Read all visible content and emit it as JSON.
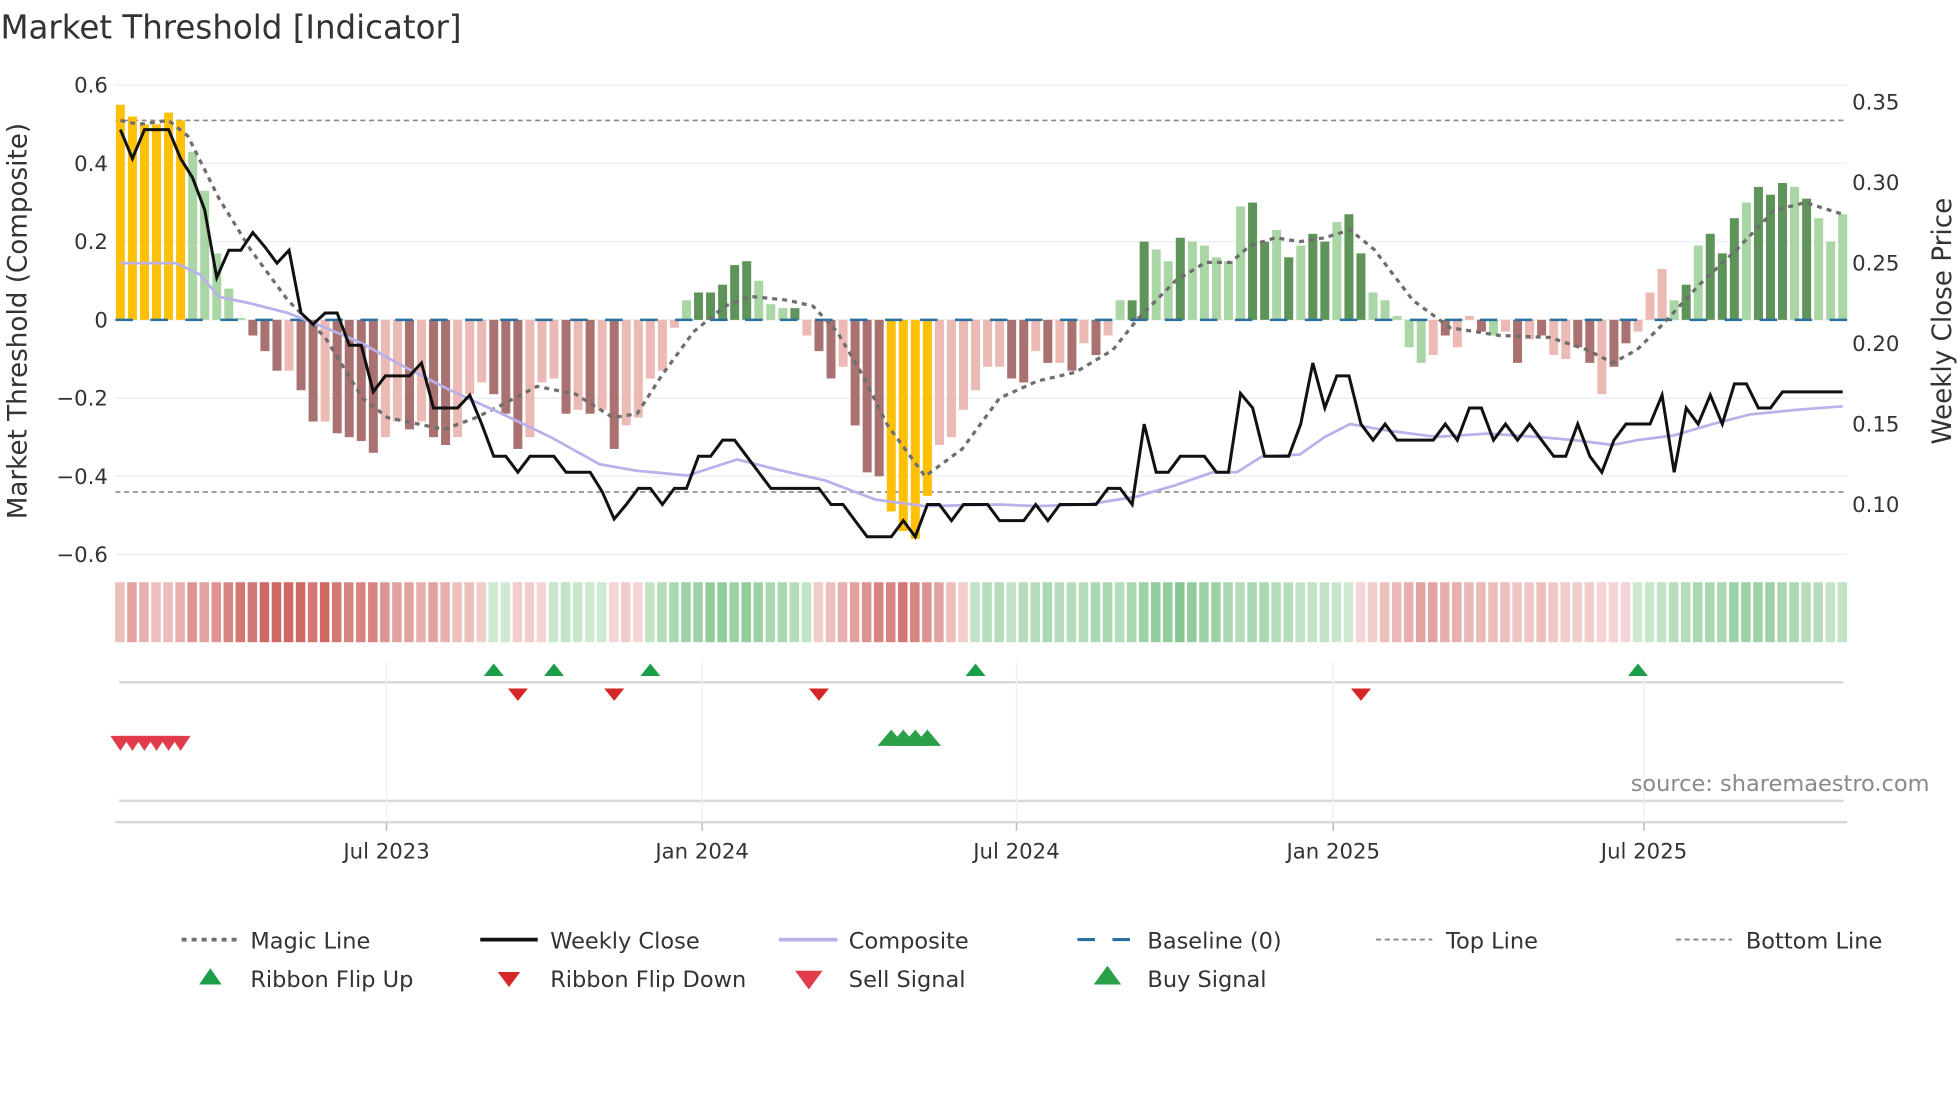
{
  "chart_data": {
    "type": "bar",
    "title": "Market Threshold [Indicator]",
    "ylabel": "Market Threshold (Composite)",
    "y2label": "Weekly Close Price",
    "ylim": [
      -0.6,
      0.6
    ],
    "y2lim": [
      0.1,
      0.35
    ],
    "yticks": [
      "0.6",
      "0.4",
      "0.2",
      "0",
      "−0.2",
      "−0.4",
      "−0.6"
    ],
    "ytick_values": [
      0.6,
      0.4,
      0.2,
      0,
      -0.2,
      -0.4,
      -0.6
    ],
    "y2ticks": [
      "0.35",
      "0.30",
      "0.25",
      "0.20",
      "0.15",
      "0.10"
    ],
    "y2tick_values": [
      0.35,
      0.3,
      0.25,
      0.2,
      0.15,
      0.1
    ],
    "x_unit": "week index (1-144)",
    "xticks": [
      {
        "label": "Jul 2023",
        "week": 23.1
      },
      {
        "label": "Jan 2024",
        "week": 49.3
      },
      {
        "label": "Jul 2024",
        "week": 75.4
      },
      {
        "label": "Jan 2025",
        "week": 101.7
      },
      {
        "label": "Jul 2025",
        "week": 127.5
      }
    ],
    "top_line": 0.51,
    "bottom_line": -0.44,
    "baseline": 0,
    "colors": {
      "Y": "#ffc107",
      "G": "#5e9459",
      "g": "#a9d6a4",
      "R": "#a97170",
      "r": "#ecbab4",
      "close": "#111111",
      "composite": "#b9b1ea",
      "magic": "#6e6e6e",
      "baseline": "#2a6f9e",
      "ribbon_red": "#c95a55",
      "ribbon_green": "#6dbb7a",
      "flip_up": "#1a9e48",
      "flip_down": "#d62728",
      "sell": "#e23b4b",
      "buy": "#2ca048"
    },
    "composite_bars": [
      0.55,
      0.52,
      0.5,
      0.5,
      0.53,
      0.51,
      0.43,
      0.33,
      0.17,
      0.08,
      0.005,
      -0.04,
      -0.08,
      -0.13,
      -0.13,
      -0.18,
      -0.26,
      -0.26,
      -0.29,
      -0.3,
      -0.31,
      -0.34,
      -0.3,
      -0.26,
      -0.28,
      -0.26,
      -0.3,
      -0.32,
      -0.3,
      -0.19,
      -0.16,
      -0.19,
      -0.24,
      -0.33,
      -0.3,
      -0.16,
      -0.15,
      -0.24,
      -0.23,
      -0.24,
      -0.23,
      -0.33,
      -0.27,
      -0.25,
      -0.15,
      -0.13,
      -0.02,
      0.05,
      0.07,
      0.07,
      0.09,
      0.14,
      0.15,
      0.1,
      0.04,
      0.03,
      0.03,
      -0.04,
      -0.08,
      -0.15,
      -0.12,
      -0.27,
      -0.39,
      -0.4,
      -0.49,
      -0.54,
      -0.56,
      -0.45,
      -0.32,
      -0.3,
      -0.23,
      -0.18,
      -0.12,
      -0.12,
      -0.15,
      -0.16,
      -0.08,
      -0.11,
      -0.11,
      -0.13,
      -0.06,
      -0.09,
      -0.04,
      0.05,
      0.05,
      0.2,
      0.18,
      0.15,
      0.21,
      0.2,
      0.19,
      0.16,
      0.15,
      0.29,
      0.3,
      0.2,
      0.23,
      0.16,
      0.19,
      0.22,
      0.2,
      0.25,
      0.27,
      0.17,
      0.07,
      0.05,
      0.01,
      -0.07,
      -0.11,
      -0.09,
      -0.04,
      -0.07,
      0.01,
      -0.03,
      -0.04,
      -0.03,
      -0.11,
      -0.05,
      -0.04,
      -0.09,
      -0.1,
      -0.07,
      -0.11,
      -0.19,
      -0.12,
      -0.06,
      -0.03,
      0.07,
      0.13,
      0.05,
      0.09,
      0.19,
      0.22,
      0.17,
      0.26,
      0.3,
      0.34,
      0.32,
      0.35,
      0.34,
      0.31,
      0.26,
      0.2,
      0.27
    ],
    "bar_color_class": "YYYYYYgggggRRRrRRrRRRRrrRrRRrrrRRRrrrRrRrRrrrrrgGGGGGgggGrRRrRRRYYYYrrrrrrRRrRrRrRrgGGggGgggggGGgGgGGgGGgggggrRrrRgrRrRrrRRrRRrrrgGgGGGgGGGgGgggggG",
    "weekly_close": [
      0.333,
      0.315,
      0.333,
      0.333,
      0.333,
      0.315,
      0.303,
      0.283,
      0.241,
      0.258,
      0.258,
      0.269,
      0.26,
      0.25,
      0.258,
      0.219,
      0.212,
      0.219,
      0.219,
      0.199,
      0.199,
      0.17,
      0.18,
      0.18,
      0.18,
      0.188,
      0.16,
      0.16,
      0.16,
      0.168,
      0.15,
      0.13,
      0.13,
      0.12,
      0.13,
      0.13,
      0.13,
      0.12,
      0.12,
      0.12,
      0.108,
      0.091,
      0.1,
      0.11,
      0.11,
      0.1,
      0.11,
      0.11,
      0.13,
      0.13,
      0.14,
      0.14,
      0.13,
      0.12,
      0.11,
      0.11,
      0.11,
      0.11,
      0.11,
      0.1,
      0.1,
      0.09,
      0.08,
      0.08,
      0.08,
      0.09,
      0.08,
      0.1,
      0.1,
      0.09,
      0.1,
      0.1,
      0.1,
      0.09,
      0.09,
      0.09,
      0.1,
      0.09,
      0.1,
      0.1,
      0.1,
      0.1,
      0.11,
      0.11,
      0.1,
      0.15,
      0.12,
      0.12,
      0.13,
      0.13,
      0.13,
      0.12,
      0.12,
      0.169,
      0.16,
      0.13,
      0.13,
      0.13,
      0.15,
      0.188,
      0.16,
      0.18,
      0.18,
      0.15,
      0.14,
      0.15,
      0.14,
      0.14,
      0.14,
      0.14,
      0.15,
      0.14,
      0.16,
      0.16,
      0.14,
      0.15,
      0.14,
      0.15,
      0.14,
      0.13,
      0.13,
      0.15,
      0.13,
      0.12,
      0.14,
      0.15,
      0.15,
      0.15,
      0.168,
      0.12,
      0.16,
      0.15,
      0.168,
      0.15,
      0.175,
      0.175,
      0.16,
      0.16,
      0.17,
      0.17,
      0.17,
      0.17,
      0.17,
      0.17
    ],
    "composite_line": [
      [
        1,
        0.25
      ],
      [
        5.6,
        0.25
      ],
      [
        7.6,
        0.243
      ],
      [
        9.2,
        0.229
      ],
      [
        11.8,
        0.225
      ],
      [
        14.9,
        0.219
      ],
      [
        18,
        0.21
      ],
      [
        21.1,
        0.2
      ],
      [
        24.2,
        0.187
      ],
      [
        28.4,
        0.171
      ],
      [
        32.5,
        0.157
      ],
      [
        36.7,
        0.142
      ],
      [
        40.8,
        0.125
      ],
      [
        43.9,
        0.121
      ],
      [
        48.1,
        0.118
      ],
      [
        52.2,
        0.128
      ],
      [
        55.4,
        0.122
      ],
      [
        59.5,
        0.115
      ],
      [
        63.7,
        0.103
      ],
      [
        67.8,
        0.099
      ],
      [
        74,
        0.1
      ],
      [
        77.1,
        0.099
      ],
      [
        81.3,
        0.1
      ],
      [
        85.4,
        0.105
      ],
      [
        88.6,
        0.112
      ],
      [
        91.7,
        0.12
      ],
      [
        93.7,
        0.12
      ],
      [
        95.8,
        0.13
      ],
      [
        98.9,
        0.131
      ],
      [
        101,
        0.142
      ],
      [
        103.1,
        0.15
      ],
      [
        106.2,
        0.146
      ],
      [
        110.3,
        0.142
      ],
      [
        114.5,
        0.144
      ],
      [
        118.6,
        0.142
      ],
      [
        121.7,
        0.14
      ],
      [
        124.9,
        0.137
      ],
      [
        126.9,
        0.14
      ],
      [
        130,
        0.143
      ],
      [
        133.2,
        0.15
      ],
      [
        136.3,
        0.156
      ],
      [
        140.4,
        0.159
      ],
      [
        144,
        0.161
      ]
    ],
    "magic_line": [
      [
        1,
        0.51
      ],
      [
        2.5,
        0.5
      ],
      [
        5,
        0.51
      ],
      [
        6.6,
        0.47
      ],
      [
        9.2,
        0.31
      ],
      [
        11.8,
        0.18
      ],
      [
        14.9,
        0.05
      ],
      [
        18,
        -0.045
      ],
      [
        21.1,
        -0.2
      ],
      [
        23.2,
        -0.25
      ],
      [
        26.3,
        -0.27
      ],
      [
        27.9,
        -0.28
      ],
      [
        30.5,
        -0.25
      ],
      [
        32.5,
        -0.22
      ],
      [
        35.6,
        -0.17
      ],
      [
        38.8,
        -0.19
      ],
      [
        41.9,
        -0.25
      ],
      [
        43.9,
        -0.24
      ],
      [
        46,
        -0.14
      ],
      [
        48.6,
        -0.03
      ],
      [
        51.2,
        0.035
      ],
      [
        53.3,
        0.06
      ],
      [
        56.4,
        0.05
      ],
      [
        58.5,
        0.035
      ],
      [
        60.5,
        -0.03
      ],
      [
        62.6,
        -0.14
      ],
      [
        64.7,
        -0.27
      ],
      [
        67.8,
        -0.4
      ],
      [
        70.9,
        -0.33
      ],
      [
        74,
        -0.2
      ],
      [
        77.1,
        -0.157
      ],
      [
        80.3,
        -0.134
      ],
      [
        83.4,
        -0.077
      ],
      [
        85.4,
        0
      ],
      [
        88.6,
        0.1
      ],
      [
        91.1,
        0.147
      ],
      [
        93.2,
        0.147
      ],
      [
        94.8,
        0.19
      ],
      [
        96.9,
        0.21
      ],
      [
        98.9,
        0.2
      ],
      [
        101,
        0.21
      ],
      [
        103.1,
        0.23
      ],
      [
        105.1,
        0.18
      ],
      [
        108.3,
        0.05
      ],
      [
        111.4,
        -0.02
      ],
      [
        115.5,
        -0.04
      ],
      [
        119.7,
        -0.045
      ],
      [
        122.8,
        -0.077
      ],
      [
        124.9,
        -0.11
      ],
      [
        126.9,
        -0.077
      ],
      [
        129,
        -0.013
      ],
      [
        132.1,
        0.09
      ],
      [
        135.2,
        0.18
      ],
      [
        138.3,
        0.28
      ],
      [
        140.9,
        0.3
      ],
      [
        144,
        0.27
      ]
    ],
    "ribbon": [
      -0.3,
      -0.5,
      -0.4,
      -0.3,
      -0.3,
      -0.4,
      -0.6,
      -0.5,
      -0.6,
      -0.7,
      -0.8,
      -0.8,
      -0.9,
      -0.9,
      -0.9,
      -0.9,
      -0.8,
      -0.9,
      -0.8,
      -0.7,
      -0.7,
      -0.7,
      -0.6,
      -0.5,
      -0.5,
      -0.4,
      -0.5,
      -0.4,
      -0.3,
      -0.3,
      -0.2,
      0.2,
      0.2,
      -0.2,
      -0.2,
      -0.15,
      0.25,
      0.3,
      0.25,
      0.2,
      0.2,
      -0.15,
      -0.2,
      -0.15,
      0.3,
      0.4,
      0.5,
      0.6,
      0.6,
      0.7,
      0.7,
      0.6,
      0.7,
      0.6,
      0.5,
      0.5,
      0.4,
      0.3,
      -0.2,
      -0.3,
      -0.4,
      -0.5,
      -0.6,
      -0.7,
      -0.7,
      -0.8,
      -0.7,
      -0.6,
      -0.5,
      -0.3,
      -0.2,
      0.3,
      0.4,
      0.4,
      0.3,
      0.4,
      0.4,
      0.5,
      0.4,
      0.4,
      0.4,
      0.5,
      0.5,
      0.4,
      0.5,
      0.6,
      0.7,
      0.7,
      0.8,
      0.7,
      0.6,
      0.6,
      0.5,
      0.4,
      0.5,
      0.5,
      0.4,
      0.4,
      0.3,
      0.3,
      0.3,
      0.25,
      0.2,
      -0.15,
      -0.2,
      -0.3,
      -0.35,
      -0.4,
      -0.5,
      -0.5,
      -0.4,
      -0.4,
      -0.35,
      -0.35,
      -0.3,
      -0.3,
      -0.25,
      -0.25,
      -0.3,
      -0.25,
      -0.2,
      -0.2,
      -0.2,
      -0.15,
      -0.15,
      -0.15,
      0.2,
      0.25,
      0.3,
      0.4,
      0.4,
      0.5,
      0.5,
      0.5,
      0.6,
      0.6,
      0.6,
      0.6,
      0.5,
      0.5,
      0.4,
      0.4,
      0.3,
      0.3
    ],
    "ribbon_flip_up": [
      32,
      37,
      45,
      72,
      127
    ],
    "ribbon_flip_down": [
      34,
      42,
      59,
      104
    ],
    "sell_signal": [
      1,
      2,
      3,
      4,
      5,
      6
    ],
    "buy_signal": [
      65,
      66,
      67,
      68
    ],
    "legend_placement": "bottom",
    "source": "source: sharemaestro.com"
  },
  "legend": [
    {
      "label": "Magic Line",
      "marker": "dotted-line"
    },
    {
      "label": "Weekly Close",
      "marker": "solid-line"
    },
    {
      "label": "Composite",
      "marker": "lavender-line"
    },
    {
      "label": "Baseline (0)",
      "marker": "dashed-line"
    },
    {
      "label": "Top Line",
      "marker": "thin-dashed-line"
    },
    {
      "label": "Bottom Line",
      "marker": "thin-dashed-line"
    },
    {
      "label": "Ribbon Flip Up",
      "marker": "triangle-up"
    },
    {
      "label": "Ribbon Flip Down",
      "marker": "triangle-down"
    },
    {
      "label": "Sell Signal",
      "marker": "triangle-down"
    },
    {
      "label": "Buy Signal",
      "marker": "triangle-up"
    }
  ]
}
